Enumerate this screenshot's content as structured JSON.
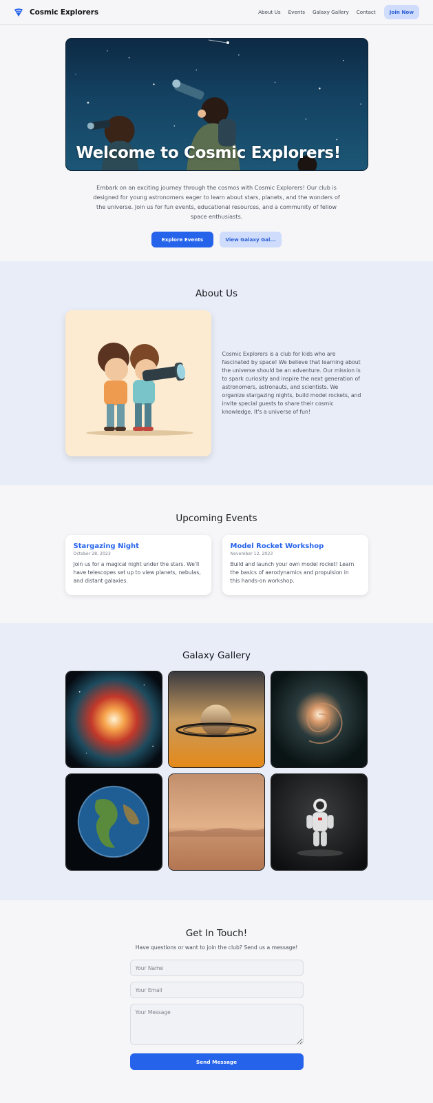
{
  "nav": {
    "brand": "Cosmic Explorers",
    "links": [
      "About Us",
      "Events",
      "Galaxy Gallery",
      "Contact"
    ],
    "cta": "Join Now"
  },
  "hero": {
    "title": "Welcome to Cosmic Explorers!",
    "text": "Embark on an exciting journey through the cosmos with Cosmic Explorers! Our club is designed for young astronomers eager to learn about stars, planets, and the wonders of the universe. Join us for fun events, educational resources, and a community of fellow space enthusiasts.",
    "primary_button": "Explore Events",
    "secondary_button": "View Galaxy Gal..."
  },
  "about": {
    "title": "About Us",
    "text": "Cosmic Explorers is a club for kids who are fascinated by space! We believe that learning about the universe should be an adventure. Our mission is to spark curiosity and inspire the next generation of astronomers, astronauts, and scientists. We organize stargazing nights, build model rockets, and invite special guests to share their cosmic knowledge. It's a universe of fun!"
  },
  "events": {
    "title": "Upcoming Events",
    "items": [
      {
        "title": "Stargazing Night",
        "date": "October 28, 2023",
        "description": "Join us for a magical night under the stars. We'll have telescopes set up to view planets, nebulas, and distant galaxies."
      },
      {
        "title": "Model Rocket Workshop",
        "date": "November 12, 2023",
        "description": "Build and launch your own model rocket! Learn the basics of aerodynamics and propulsion in this hands-on workshop."
      }
    ]
  },
  "gallery": {
    "title": "Galaxy Gallery",
    "images": [
      "nebula-image",
      "saturn-image",
      "spiral-galaxy-image",
      "earth-image",
      "mars-surface-image",
      "astronaut-image"
    ]
  },
  "contact": {
    "title": "Get In Touch!",
    "subtitle": "Have questions or want to join the club? Send us a message!",
    "name_placeholder": "Your Name",
    "email_placeholder": "Your Email",
    "message_placeholder": "Your Message",
    "submit": "Send Message"
  },
  "colors": {
    "accent": "#2563eb",
    "accent_light": "#cfdcfb",
    "section_alt_bg": "#e9edf7",
    "page_bg": "#f6f6f8"
  }
}
